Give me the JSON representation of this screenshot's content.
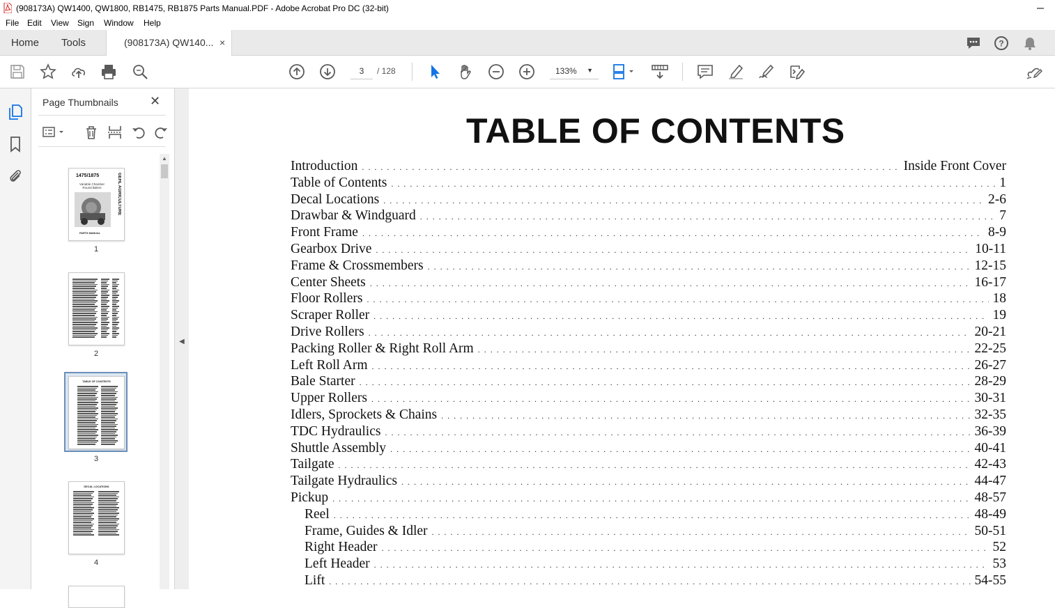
{
  "window": {
    "title": "(908173A) QW1400, QW1800, RB1475, RB1875 Parts Manual.PDF - Adobe Acrobat Pro DC (32-bit)"
  },
  "menu": [
    "File",
    "Edit",
    "View",
    "Sign",
    "Window",
    "Help"
  ],
  "tabs": {
    "home": "Home",
    "tools": "Tools",
    "document": "(908173A) QW140...",
    "close": "×"
  },
  "toolbar": {
    "page_current": "3",
    "page_total": "/   128",
    "zoom": "133%"
  },
  "panel": {
    "title": "Page Thumbnails",
    "close": "✕",
    "thumbnails": [
      {
        "number": "1",
        "cover_title": "1475/1875",
        "cover_sub1": "Variable Chamber",
        "cover_sub2": "Round Balers",
        "cover_brand": "GEHL AGRICULTURE",
        "cover_footer": "PARTS MANUAL"
      },
      {
        "number": "2"
      },
      {
        "number": "3",
        "heading": "TABLE OF CONTENTS"
      },
      {
        "number": "4",
        "heading": "DECAL LOCATIONS"
      }
    ]
  },
  "document": {
    "title": "TABLE OF CONTENTS",
    "entries": [
      {
        "label": "Introduction",
        "page": "Inside Front Cover"
      },
      {
        "label": "Table of Contents",
        "page": "1"
      },
      {
        "label": "Decal Locations",
        "page": "2-6"
      },
      {
        "label": "Drawbar & Windguard",
        "page": "7"
      },
      {
        "label": "Front Frame",
        "page": "8-9"
      },
      {
        "label": "Gearbox Drive",
        "page": "10-11"
      },
      {
        "label": "Frame & Crossmembers",
        "page": "12-15"
      },
      {
        "label": "Center Sheets",
        "page": "16-17"
      },
      {
        "label": "Floor Rollers",
        "page": "18"
      },
      {
        "label": "Scraper Roller",
        "page": "19"
      },
      {
        "label": "Drive Rollers",
        "page": "20-21"
      },
      {
        "label": "Packing Roller & Right Roll Arm",
        "page": "22-25"
      },
      {
        "label": "Left Roll Arm",
        "page": "26-27"
      },
      {
        "label": "Bale Starter",
        "page": "28-29"
      },
      {
        "label": "Upper Rollers",
        "page": "30-31"
      },
      {
        "label": "Idlers, Sprockets & Chains",
        "page": "32-35"
      },
      {
        "label": "TDC Hydraulics",
        "page": "36-39"
      },
      {
        "label": "Shuttle Assembly",
        "page": "40-41"
      },
      {
        "label": "Tailgate",
        "page": "42-43"
      },
      {
        "label": "Tailgate Hydraulics",
        "page": "44-47"
      },
      {
        "label": "Pickup",
        "page": "48-57"
      },
      {
        "label": "Reel",
        "page": "48-49",
        "indent": true
      },
      {
        "label": "Frame, Guides & Idler",
        "page": "50-51",
        "indent": true
      },
      {
        "label": "Right Header",
        "page": "52",
        "indent": true
      },
      {
        "label": "Left Header",
        "page": "53",
        "indent": true
      },
      {
        "label": "Lift",
        "page": "54-55",
        "indent": true
      }
    ]
  },
  "colors": {
    "acrobat_red": "#d7261e",
    "select_blue": "#1473e6",
    "icon_gray": "#5a5a5a"
  },
  "icons": [
    "save-icon",
    "bookmark-star-icon",
    "upload-icon",
    "print-icon",
    "find-icon",
    "prev-page-icon",
    "next-page-icon",
    "select-cursor-icon",
    "hand-icon",
    "zoom-out-icon",
    "zoom-in-icon",
    "page-fit-icon",
    "scroll-mode-icon",
    "comment-icon",
    "highlight-icon",
    "sign-icon",
    "edit-pdf-icon",
    "share-link-icon",
    "chat-icon",
    "help-icon",
    "bell-icon",
    "pages-icon",
    "bookmark-icon",
    "attachment-icon"
  ]
}
